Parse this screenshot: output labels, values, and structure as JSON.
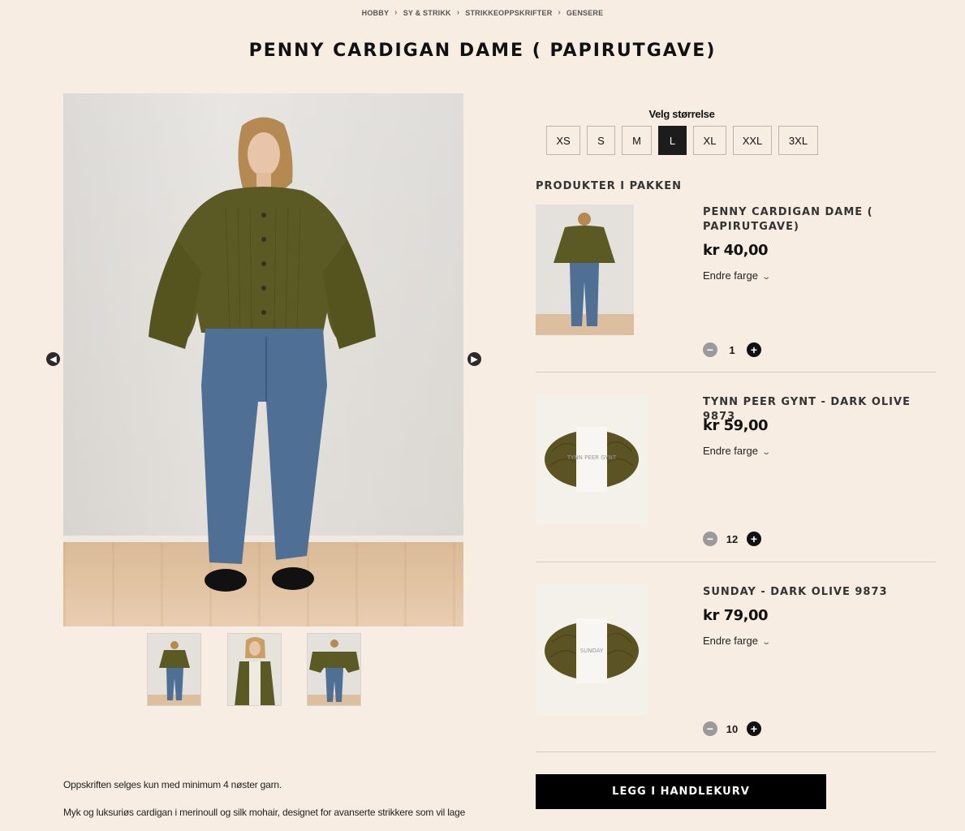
{
  "breadcrumb": [
    "HOBBY",
    "SY & STRIKK",
    "STRIKKEOPPSKRIFTER",
    "GENSERE"
  ],
  "title": "PENNY CARDIGAN DAME ( PAPIRUTGAVE)",
  "gallery": {
    "prev_icon": "chevron-left-icon",
    "next_icon": "chevron-right-icon",
    "thumbnails": [
      "thumbnail-1",
      "thumbnail-2",
      "thumbnail-3"
    ]
  },
  "size_selector": {
    "label": "Velg størrelse",
    "options": [
      "XS",
      "S",
      "M",
      "L",
      "XL",
      "XXL",
      "3XL"
    ],
    "selected": "L"
  },
  "package": {
    "heading": "PRODUKTER I PAKKEN",
    "change_color_label": "Endre farge",
    "items": [
      {
        "name": "PENNY CARDIGAN DAME ( PAPIRUTGAVE)",
        "price": "kr 40,00",
        "quantity": "1"
      },
      {
        "name": "TYNN PEER GYNT - DARK OLIVE 9873",
        "price": "kr 59,00",
        "quantity": "12",
        "label_text": "TYNN PEER GYNT"
      },
      {
        "name": "SUNDAY - DARK OLIVE 9873",
        "price": "kr 79,00",
        "quantity": "10",
        "label_text": "SUNDAY"
      }
    ]
  },
  "cart_button": "LEGG I HANDLEKURV",
  "description": {
    "line1": "Oppskriften selges kun med minimum 4 nøster garn.",
    "line2": "Myk og luksuriøs cardigan i merinoull og silk mohair, designet for avanserte strikkere som vil lage"
  },
  "colors": {
    "background": "#f7ede3",
    "accent": "#1c1c1c",
    "olive": "#5b5a24",
    "denim": "#4f6f95"
  }
}
